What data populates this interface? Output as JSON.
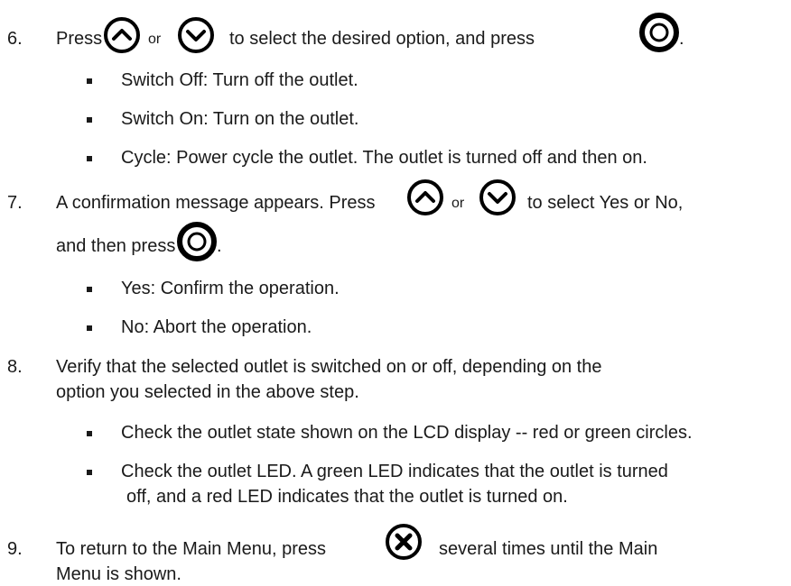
{
  "steps": [
    {
      "number": "6.",
      "parts": [
        "Press",
        "or",
        "to select the desired option, and press",
        "."
      ],
      "bullets": [
        "Switch Off: Turn off the outlet.",
        "Switch On: Turn on the outlet.",
        "Cycle: Power cycle the outlet. The outlet is turned off and then on."
      ]
    },
    {
      "number": "7.",
      "parts": [
        "A confirmation message appears. Press",
        "or",
        "to select Yes or No,",
        "and then press",
        "."
      ],
      "bullets": [
        "Yes: Confirm the operation.",
        "No: Abort the operation."
      ]
    },
    {
      "number": "8.",
      "lines": [
        "Verify that the selected outlet is switched on or off, depending on the",
        "option you selected in the above step."
      ],
      "bullets": [
        "Check the outlet state shown on the LCD display -- red or green circles.",
        "Check the outlet LED. A green LED indicates that the outlet is turned",
        "off, and a red LED indicates that the outlet is turned on."
      ]
    },
    {
      "number": "9.",
      "parts": [
        "To return to the Main Menu, press",
        "several times until the Main"
      ],
      "lines": [
        "Menu is shown."
      ]
    }
  ],
  "icons": {
    "up": "up-button-icon",
    "down": "down-button-icon",
    "ok": "ok-button-icon",
    "cancel": "cancel-button-icon"
  }
}
